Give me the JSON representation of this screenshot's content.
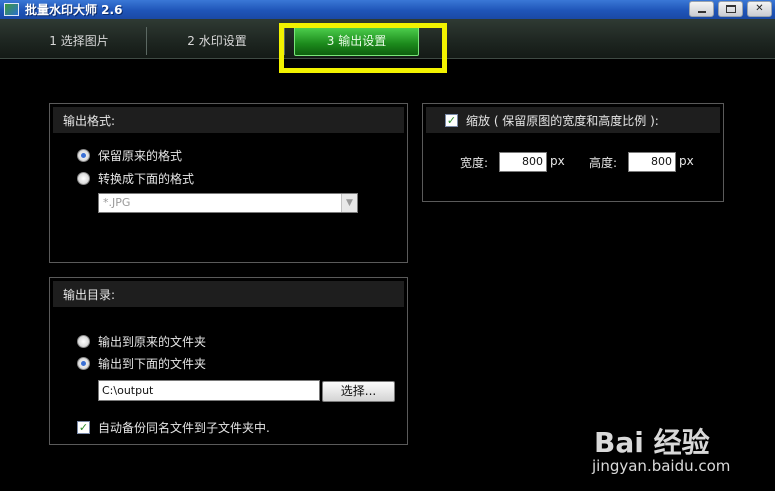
{
  "window": {
    "title": "批量水印大师 2.6"
  },
  "tabs": [
    {
      "label": "1  选择图片"
    },
    {
      "label": "2  水印设置"
    },
    {
      "label": "3  输出设置"
    }
  ],
  "format_panel": {
    "header": "输出格式:",
    "option_keep": "保留原来的格式",
    "option_convert": "转换成下面的格式",
    "format_select_value": "*.JPG"
  },
  "dir_panel": {
    "header": "输出目录:",
    "option_original": "输出到原来的文件夹",
    "option_below": "输出到下面的文件夹",
    "path_value": "C:\\output",
    "browse_label": "选择...",
    "backup_label": "自动备份同名文件到子文件夹中."
  },
  "scale_panel": {
    "header": "缩放 ( 保留原图的宽度和高度比例 ):",
    "width_label": "宽度:",
    "width_value": "800",
    "height_label": "高度:",
    "height_value": "800",
    "unit": "px"
  },
  "watermark": {
    "logo": "Bai 经验",
    "url": "jingyan.baidu.com"
  },
  "colors": {
    "active_tab": "#1c8a1c",
    "highlight": "#f2f200",
    "titlebar": "#1f55b8"
  }
}
